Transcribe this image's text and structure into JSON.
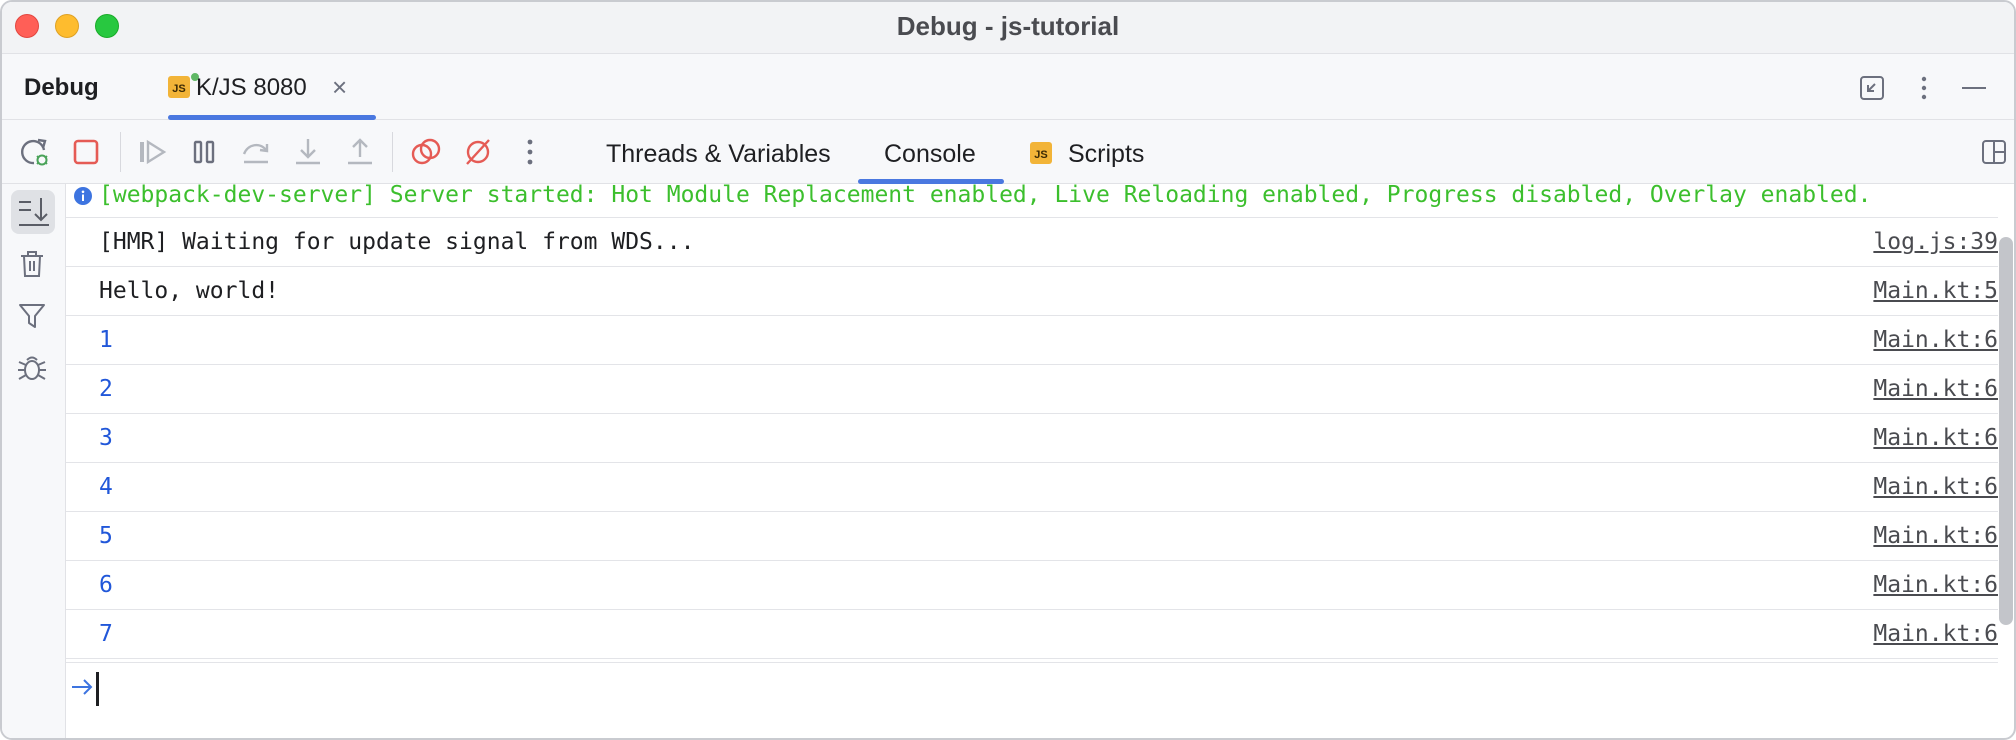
{
  "window": {
    "title": "Debug - js-tutorial"
  },
  "tool_window": {
    "title": "Debug",
    "run_tab": {
      "label": "K/JS 8080",
      "icon": "js-icon",
      "close_icon": "close-icon"
    },
    "header_actions": [
      "restore-layout-icon",
      "more-vertical-icon",
      "minimize-icon"
    ]
  },
  "toolbar": {
    "icons": [
      "rerun-debug-icon",
      "stop-icon",
      "resume-icon",
      "pause-icon",
      "step-over-icon",
      "step-into-icon",
      "step-out-icon",
      "view-breakpoints-icon",
      "mute-breakpoints-icon",
      "more-vertical-icon"
    ],
    "tabs": [
      {
        "label": "Threads & Variables",
        "active": false
      },
      {
        "label": "Console",
        "active": true
      },
      {
        "label": "Scripts",
        "active": false,
        "icon": "js-icon"
      }
    ],
    "right_icon": "layout-icon"
  },
  "gutter": {
    "icons": [
      "scroll-to-end-icon",
      "trash-icon",
      "filter-icon",
      "bug-icon"
    ],
    "selected": "scroll-to-end-icon"
  },
  "console": {
    "banner": "[webpack-dev-server] Server started: Hot Module Replacement enabled, Live Reloading enabled, Progress disabled, Overlay enabled.",
    "rows": [
      {
        "text": "[HMR] Waiting for update signal from WDS...",
        "link": "log.js:39",
        "style": "black"
      },
      {
        "text": "Hello, world!",
        "link": "Main.kt:5",
        "style": "black"
      },
      {
        "text": "1",
        "link": "Main.kt:6",
        "style": "blue"
      },
      {
        "text": "2",
        "link": "Main.kt:6",
        "style": "blue"
      },
      {
        "text": "3",
        "link": "Main.kt:6",
        "style": "blue"
      },
      {
        "text": "4",
        "link": "Main.kt:6",
        "style": "blue"
      },
      {
        "text": "5",
        "link": "Main.kt:6",
        "style": "blue"
      },
      {
        "text": "6",
        "link": "Main.kt:6",
        "style": "blue"
      },
      {
        "text": "7",
        "link": "Main.kt:6",
        "style": "blue"
      }
    ],
    "input_value": ""
  },
  "colors": {
    "accent": "#4a78e0",
    "log_green": "#3cbf2d",
    "number_blue": "#2157d9",
    "stop_red": "#e55b55",
    "js_badge": "#f2b438"
  }
}
